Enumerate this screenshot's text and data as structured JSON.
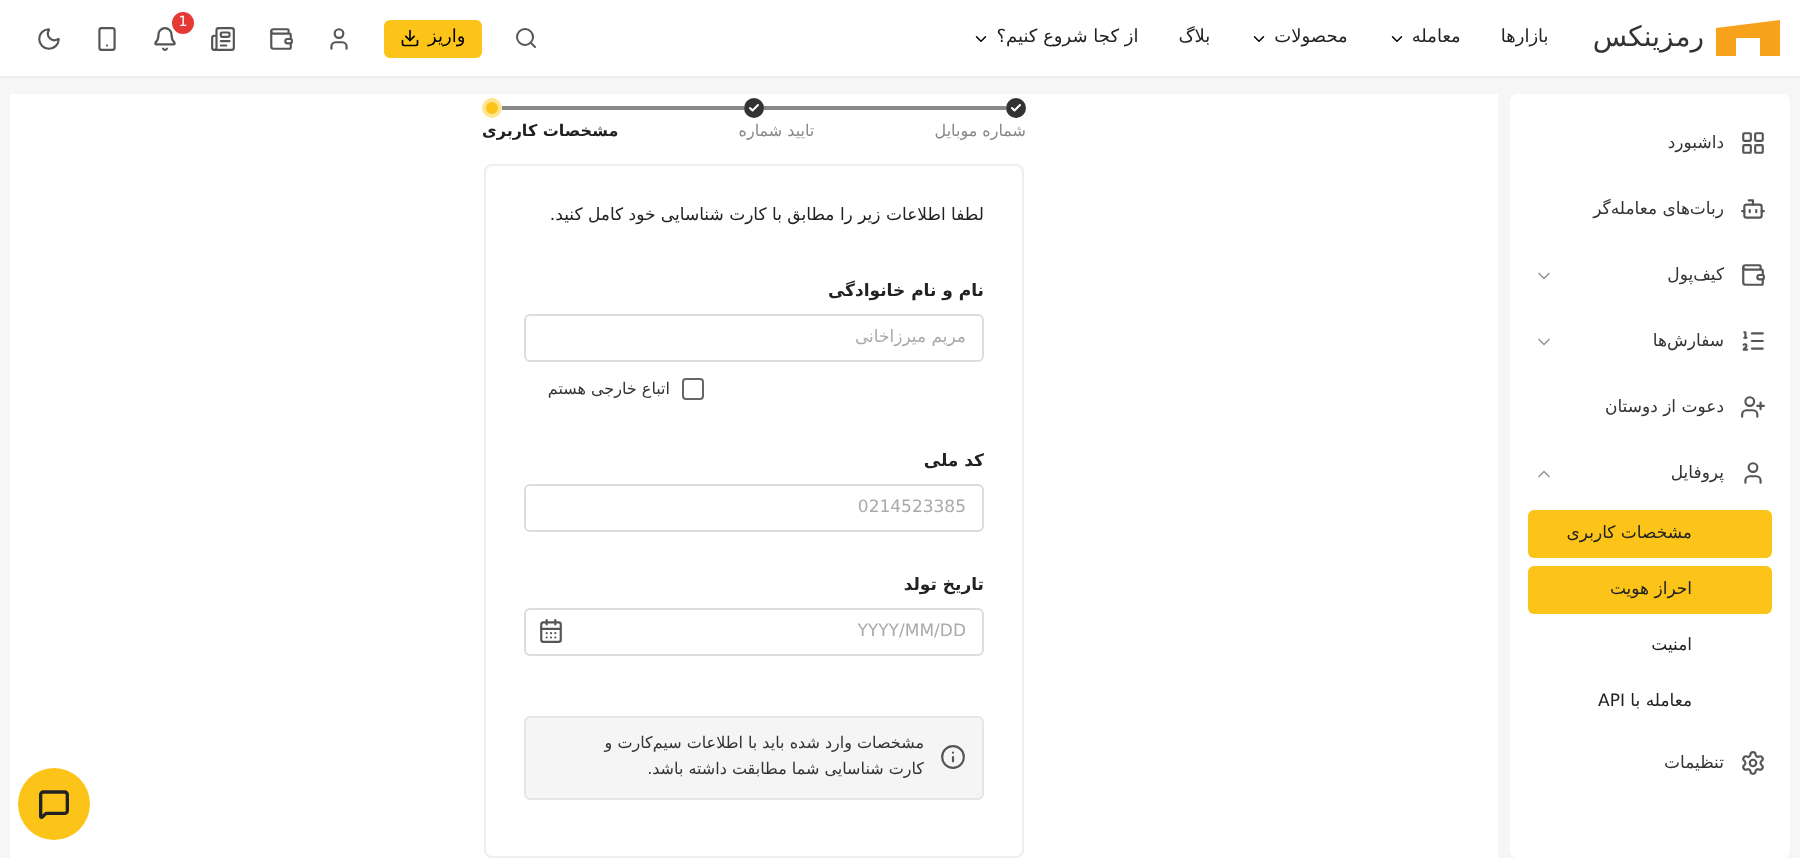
{
  "header": {
    "logo": "رمزینکس",
    "nav": [
      {
        "label": "بازارها",
        "dropdown": false
      },
      {
        "label": "معامله",
        "dropdown": true
      },
      {
        "label": "محصولات",
        "dropdown": true
      },
      {
        "label": "بلاگ",
        "dropdown": false
      },
      {
        "label": "از کجا شروع کنیم؟",
        "dropdown": true
      }
    ],
    "deposit_button": "واریز",
    "notification_count": "1"
  },
  "stepper": [
    {
      "label": "شماره موبایل",
      "done": true,
      "selected": false
    },
    {
      "label": "تایید شماره",
      "done": true,
      "selected": false
    },
    {
      "label": "مشخصات کاربری",
      "done": false,
      "selected": true
    }
  ],
  "form": {
    "intro": "لطفا اطلاعات زیر را مطابق با کارت شناسایی خود کامل کنید.",
    "name_label": "نام و نام خانوادگی",
    "name_placeholder": "مریم میرزاخانی",
    "foreign": {
      "label": "اتباع خارجی هستم",
      "checked": false
    },
    "national_code_label": "کد ملی",
    "national_code_placeholder": "0214523385",
    "birth_label": "تاریخ تولد",
    "birth_placeholder": "YYYY/MM/DD",
    "notice": "مشخصات وارد شده باید با اطلاعات سیم‌کارت و کارت شناسایی شما مطابقت داشته باشد."
  },
  "sidebar": [
    {
      "kind": "item",
      "label": "داشبورد"
    },
    {
      "kind": "item",
      "label": "ربات‌های معامله‌گر"
    },
    {
      "kind": "item",
      "label": "کیف‌پول",
      "expanded": false
    },
    {
      "kind": "item",
      "label": "سفارش‌ها",
      "expanded": false
    },
    {
      "kind": "item",
      "label": "دعوت از دوستان"
    },
    {
      "kind": "item",
      "label": "پروفایل",
      "expanded": true
    },
    {
      "kind": "sub",
      "label": "مشخصات کاربری",
      "selected": true
    },
    {
      "kind": "sub",
      "label": "احراز هویت",
      "selected": true
    },
    {
      "kind": "sub",
      "label": "امنیت",
      "selected": false
    },
    {
      "kind": "sub",
      "label": "معامله با API",
      "selected": false
    },
    {
      "kind": "item",
      "label": "تنظیمات"
    }
  ]
}
